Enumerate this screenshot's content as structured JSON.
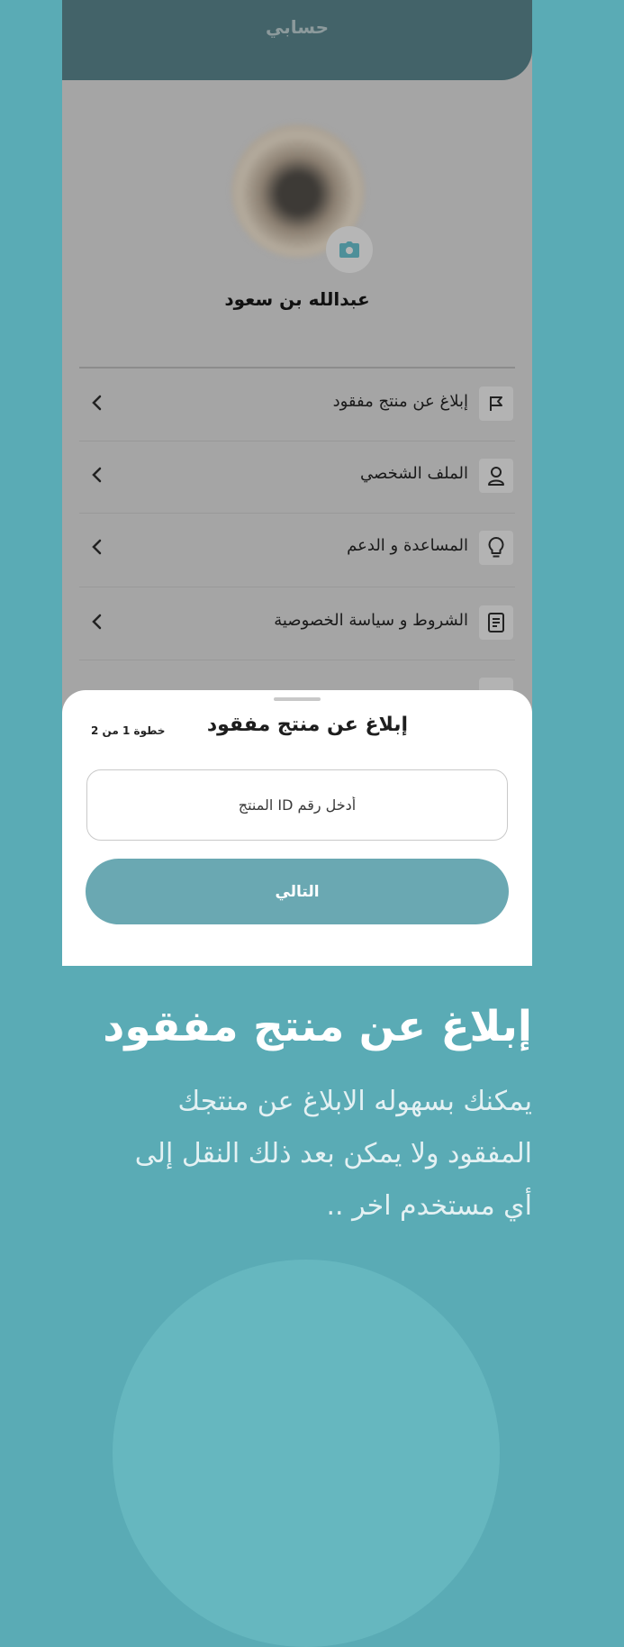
{
  "header": {
    "title": "حسابي"
  },
  "profile": {
    "name": "عبدالله بن سعود",
    "camera_icon": "camera-icon"
  },
  "menu": {
    "items": [
      {
        "label": "إبلاغ عن منتج مفقود",
        "icon": "flag-icon"
      },
      {
        "label": "الملف الشخصي",
        "icon": "user-icon"
      },
      {
        "label": "المساعدة و الدعم",
        "icon": "lightbulb-icon"
      },
      {
        "label": "الشروط و سياسة الخصوصية",
        "icon": "document-icon"
      }
    ]
  },
  "sheet": {
    "title": "إبلاغ عن منتج مفقود",
    "step": "خطوة 1 من 2",
    "input_placeholder": "أدخل رقم ID المنتج",
    "next_label": "التالي"
  },
  "promo": {
    "title": "إبلاغ عن منتج مفقود",
    "description": "يمكنك بسهوله الابلاغ عن منتجك المفقود ولا يمكن بعد ذلك النقل إلى أي مستخدم اخر .."
  },
  "colors": {
    "background": "#5aabb5",
    "header": "#436369",
    "overlay": "#a5a5a5",
    "button": "#6aa8b2"
  }
}
